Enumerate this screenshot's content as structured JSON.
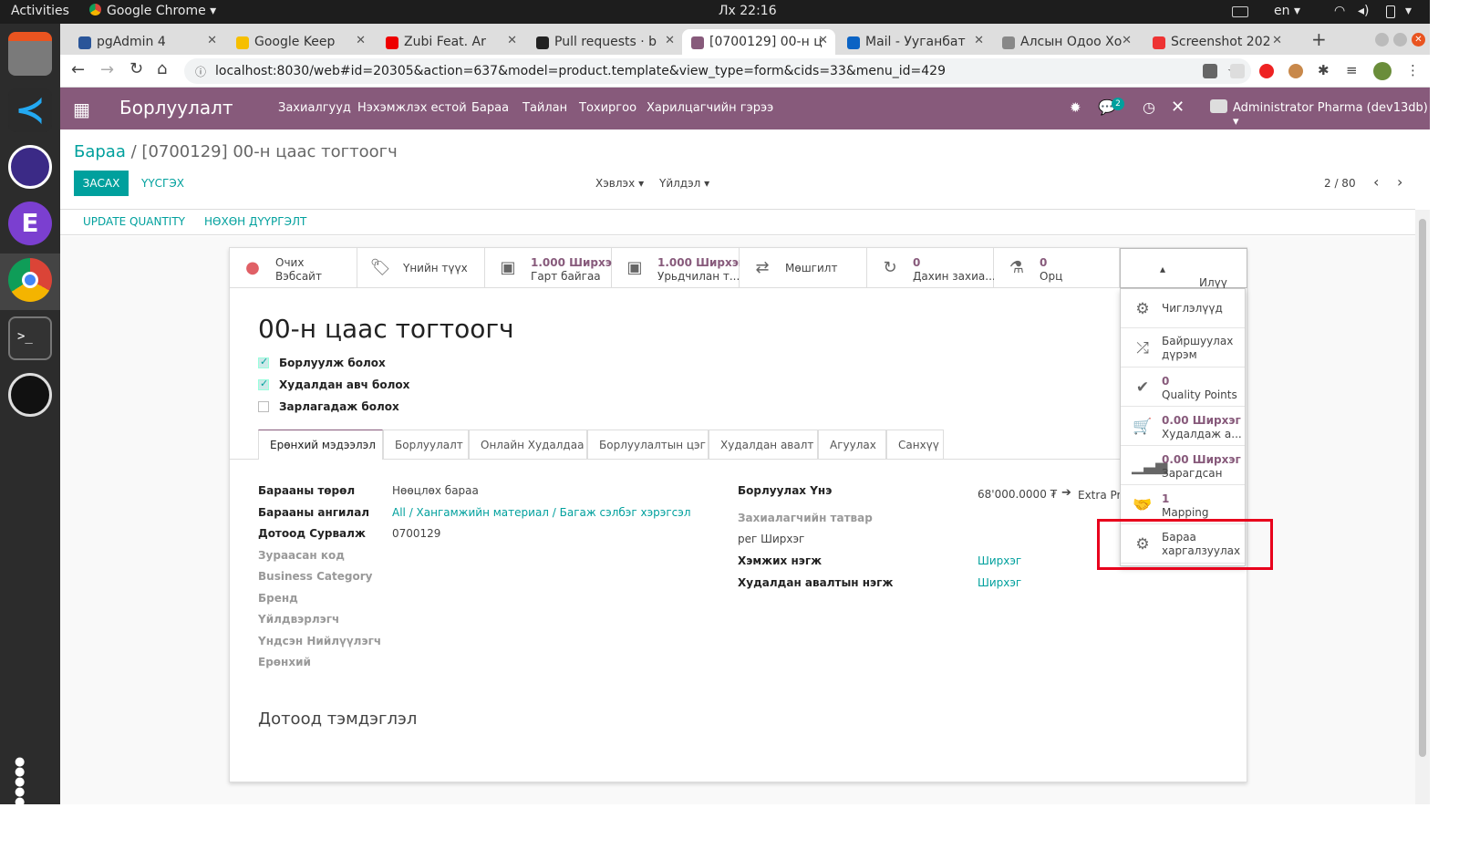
{
  "os": {
    "activities": "Activities",
    "app": "Google Chrome",
    "clock": "Лх 22:16",
    "lang": "en"
  },
  "browser": {
    "tabs": [
      {
        "label": "pgAdmin 4",
        "color": "#2a5599"
      },
      {
        "label": "Google Keep",
        "color": "#f6bf00"
      },
      {
        "label": "Zubi Feat. Ar",
        "color": "#e00"
      },
      {
        "label": "Pull requests · b",
        "color": "#222"
      },
      {
        "label": "[0700129] 00-н ц",
        "color": "#875a7b"
      },
      {
        "label": "Mail - Ууганбат",
        "color": "#0b63c4"
      },
      {
        "label": "Алсын Одоо Хо",
        "color": "#888"
      },
      {
        "label": "Screenshot 202",
        "color": "#e33"
      }
    ],
    "url": "localhost:8030/web#id=20305&action=637&model=product.template&view_type=form&cids=33&menu_id=429"
  },
  "navbar": {
    "brand": "Борлуулалт",
    "menus": [
      "Захиалгууд",
      "Нэхэмжлэх естой",
      "Бараа",
      "Тайлан",
      "Тохиргоо",
      "Харилцагчийн гэрээ"
    ],
    "chat_count": "2",
    "user": "Administrator Pharma (dev13db)"
  },
  "control": {
    "crumb_link": "Бараа",
    "crumb_sep": "/",
    "crumb_current": "[0700129] 00-н цаас тогтоогч",
    "edit": "ЗАСАХ",
    "create": "ҮҮСГЭХ",
    "print": "Хэвлэх",
    "action": "Үйлдэл",
    "pager": "2 / 80"
  },
  "statusbar": {
    "update_qty": "UPDATE QUANTITY",
    "replenish": "НӨХӨН ДҮҮРГЭЛТ"
  },
  "buttons": [
    {
      "a": "Очих",
      "b": "Вэбсайт",
      "icon": "globe-icon"
    },
    {
      "a": "",
      "b": "Үнийн түүх",
      "icon": "tags-icon"
    },
    {
      "a": "1.000 Ширхэг",
      "b": "Гарт байгаа",
      "icon": "cubes-icon"
    },
    {
      "a": "1.000 Ширхэг",
      "b": "Урьдчилан т...",
      "icon": "cubes-icon"
    },
    {
      "a": "",
      "b": "Мөшгилт",
      "icon": "arrows-icon"
    },
    {
      "a": "0",
      "b": "Дахин захиа...",
      "icon": "refresh-icon"
    },
    {
      "a": "0",
      "b": "Орц",
      "icon": "flask-icon"
    }
  ],
  "more_label": "Илүү",
  "more_items": [
    {
      "a": "",
      "b": "Чиглэлүүд"
    },
    {
      "a": "",
      "b": "Байршуулах дүрэм"
    },
    {
      "a": "0",
      "b": "Quality Points"
    },
    {
      "a": "0.00 Ширхэг",
      "b": "Худалдаж а..."
    },
    {
      "a": "0.00 Ширхэг",
      "b": "Зарагдсан"
    },
    {
      "a": "1",
      "b": "Mapping"
    },
    {
      "a": "",
      "b": "Бараа харгалзуулах"
    }
  ],
  "product": {
    "name": "00-н цаас тогтоогч",
    "can_sell": "Борлуулж болох",
    "can_buy": "Худалдан авч болох",
    "can_expense": "Зарлагадаж болох"
  },
  "tabs": [
    "Ерөнхий мэдээлэл",
    "Борлуулалт",
    "Онлайн Худалдаа",
    "Борлуулалтын цэг",
    "Худалдан авалт",
    "Агуулах",
    "Санхүү"
  ],
  "left_fields": [
    {
      "label": "Барааны төрөл",
      "value": "Нөөцлөх бараа",
      "muted": false,
      "link": false
    },
    {
      "label": "Барааны ангилал",
      "value": "All / Хангамжийн материал / Багаж сэлбэг хэрэгсэл",
      "muted": false,
      "link": true
    },
    {
      "label": "Дотоод Сурвалж",
      "value": "0700129",
      "muted": false,
      "link": false
    },
    {
      "label": "Зураасан код",
      "value": "",
      "muted": true,
      "link": false
    },
    {
      "label": "Business Category",
      "value": "",
      "muted": true,
      "link": false
    },
    {
      "label": "Бренд",
      "value": "",
      "muted": true,
      "link": false
    },
    {
      "label": "Үйлдвэрлэгч",
      "value": "",
      "muted": true,
      "link": false
    },
    {
      "label": "Үндсэн Нийлүүлэгч",
      "value": "",
      "muted": true,
      "link": false
    },
    {
      "label": "Ерөнхий",
      "value": "",
      "muted": true,
      "link": false
    }
  ],
  "right_fields": {
    "price_label": "Борлуулах Үнэ",
    "price_value": "68'000.0000 ₮",
    "extra": "Extra Pr",
    "tax_label": "Захиалагчийн татвар",
    "per_unit": "рег Ширхэг",
    "uom_label": "Хэмжих нэгж",
    "uom_value": "Ширхэг",
    "po_uom_label": "Худалдан авалтын нэгж",
    "po_uom_value": "Ширхэг"
  },
  "notes_title": "Дотоод тэмдэглэл"
}
